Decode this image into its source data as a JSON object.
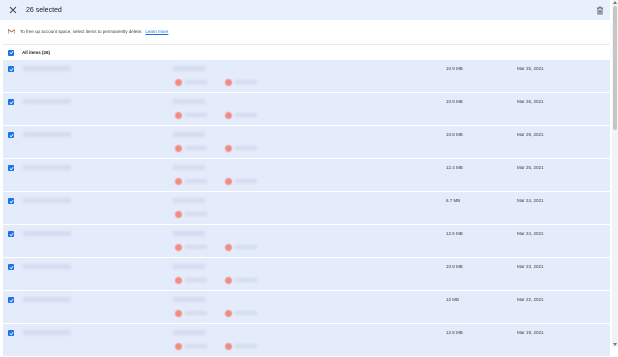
{
  "header": {
    "title": "26 selected"
  },
  "info": {
    "text": "To free up account space, select items to permanently delete.",
    "link": "Learn more"
  },
  "list": {
    "all_label": "All items (26)",
    "rows": [
      {
        "size": "10.9 MB",
        "date": "Mar 25, 2021",
        "chips": 2
      },
      {
        "size": "10.9 MB",
        "date": "Mar 26, 2021",
        "chips": 2
      },
      {
        "size": "10.8 MB",
        "date": "Mar 29, 2021",
        "chips": 2
      },
      {
        "size": "12.4 MB",
        "date": "Mar 25, 2021",
        "chips": 2
      },
      {
        "size": "6.7 MB",
        "date": "Mar 24, 2021",
        "chips": 1
      },
      {
        "size": "12.5 MB",
        "date": "Mar 24, 2021",
        "chips": 2
      },
      {
        "size": "10.9 MB",
        "date": "Mar 23, 2021",
        "chips": 2
      },
      {
        "size": "12 MB",
        "date": "Mar 22, 2021",
        "chips": 2
      },
      {
        "size": "12.8 MB",
        "date": "Mar 19, 2021",
        "chips": 2
      }
    ]
  },
  "colors": {
    "accent": "#1a73e8",
    "header_bg": "#e8f0fe",
    "row_selected_bg": "#e4ebfa"
  },
  "icons": {
    "close": "close-icon",
    "trash": "delete-icon",
    "gmail": "gmail-icon",
    "checkbox": "checkbox-checked-icon"
  }
}
